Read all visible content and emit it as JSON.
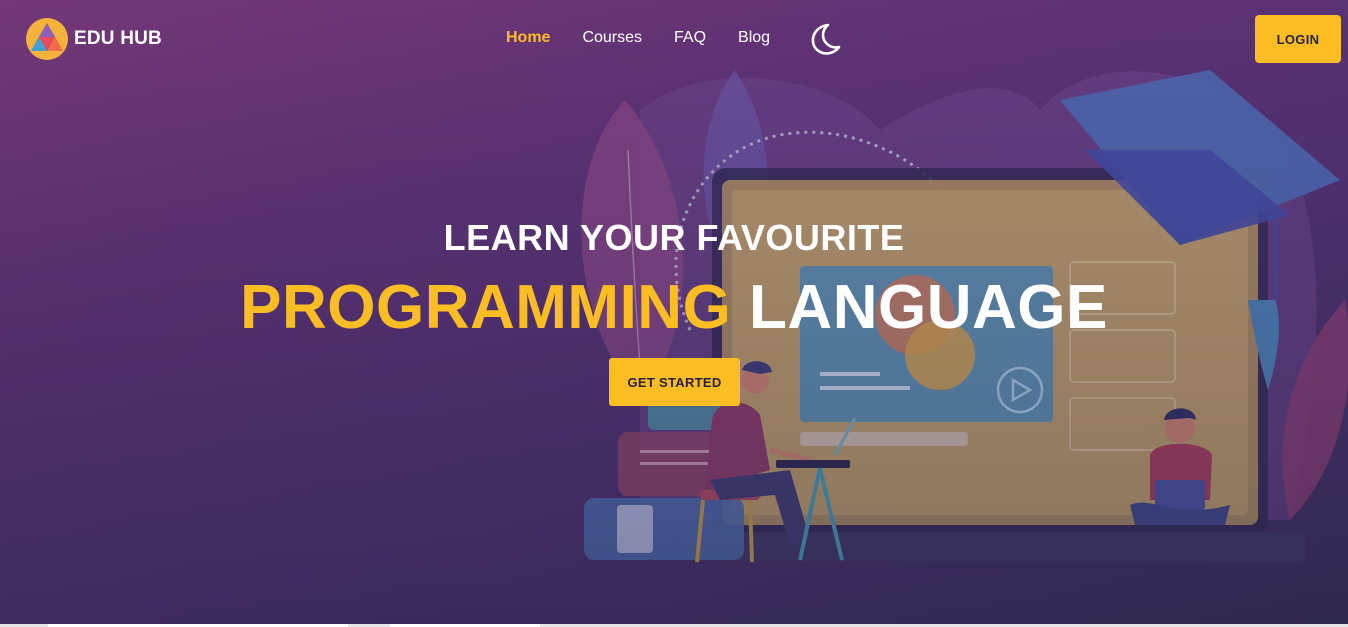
{
  "brand": {
    "name": "EDU HUB",
    "logo_icon": "tricolor-triangle-logo"
  },
  "nav": {
    "items": [
      {
        "label": "Home",
        "active": true
      },
      {
        "label": "Courses",
        "active": false
      },
      {
        "label": "FAQ",
        "active": false
      },
      {
        "label": "Blog",
        "active": false
      }
    ],
    "theme_toggle_icon": "moon-icon",
    "login_label": "LOGIN"
  },
  "hero": {
    "headline": "LEARN YOUR FAVOURITE",
    "subheadline_highlight": "PROGRAMMING",
    "subheadline_rest": "LANGUAGE",
    "cta_label": "GET STARTED",
    "illustration": "online-learning-illustration"
  },
  "colors": {
    "accent": "#fbbd24",
    "text_on_dark": "#ffffff",
    "button_text": "#2a2140",
    "background_top": "#7a3a78",
    "background_bottom": "#352f55"
  }
}
